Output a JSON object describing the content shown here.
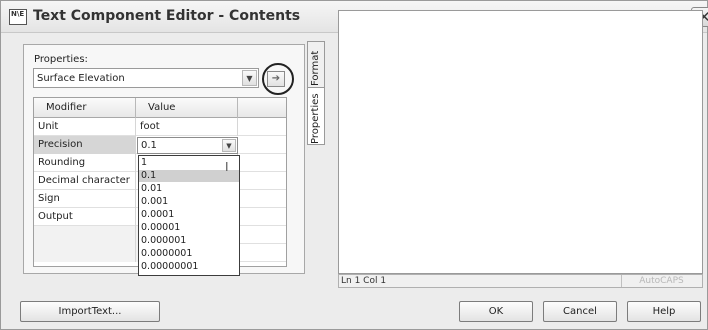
{
  "window": {
    "title": "Text Component Editor - Contents",
    "icon_text": "N\\E"
  },
  "tabs": [
    "Properties",
    "Format"
  ],
  "properties_panel": {
    "label": "Properties:",
    "selected": "Surface Elevation"
  },
  "grid": {
    "headers": [
      "Modifier",
      "Value"
    ],
    "rows": [
      {
        "modifier": "Unit",
        "value": "foot"
      },
      {
        "modifier": "Precision",
        "value": "0.1"
      },
      {
        "modifier": "Rounding",
        "value": ""
      },
      {
        "modifier": "Decimal character",
        "value": ""
      },
      {
        "modifier": "Sign",
        "value": ""
      },
      {
        "modifier": "Output",
        "value": ""
      }
    ]
  },
  "precision_dropdown": {
    "options": [
      "1",
      "0.1",
      "0.01",
      "0.001",
      "0.0001",
      "0.00001",
      "0.000001",
      "0.0000001",
      "0.00000001"
    ],
    "highlighted": "0.1"
  },
  "statusbar": {
    "position": "Ln 1 Col 1",
    "caps": "AutoCAPS"
  },
  "buttons": {
    "import": "ImportText...",
    "ok": "OK",
    "cancel": "Cancel",
    "help": "Help"
  }
}
